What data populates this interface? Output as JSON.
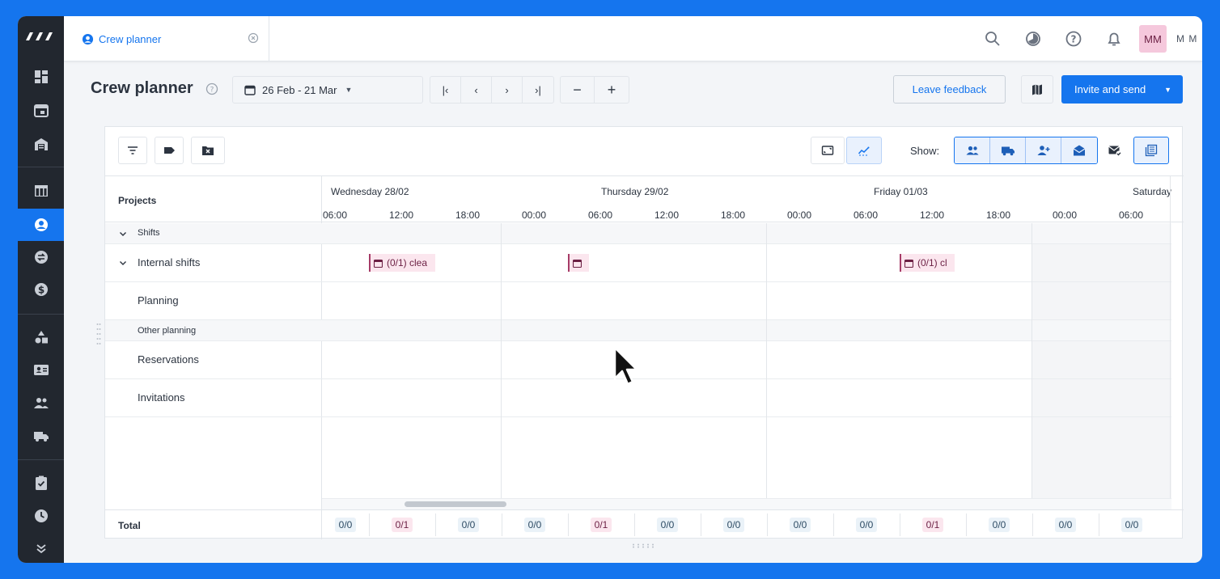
{
  "app": {
    "tab_label": "Crew planner",
    "user_initials": "MM",
    "user_name": "M M",
    "accent_color": "#1575ee",
    "rail_icons": [
      "dashboard-icon",
      "calendar-icon",
      "warehouse-icon",
      "table-icon",
      "crew-icon",
      "swap-icon",
      "dollar-icon",
      "shapes-icon",
      "contact-card-icon",
      "people-icon",
      "truck-icon",
      "clipboard-check-icon",
      "clock-icon",
      "expand-down-icon"
    ]
  },
  "header": {
    "title": "Crew planner",
    "date_range": "26 Feb - 21 Mar",
    "leave_feedback": "Leave feedback",
    "invite_and_send": "Invite and send"
  },
  "toolbar": {
    "show_label": "Show:"
  },
  "grid": {
    "projects_label": "Projects",
    "days": [
      "Wednesday 28/02",
      "Thursday 29/02",
      "Friday 01/03",
      "Saturday"
    ],
    "hours": [
      "06:00",
      "12:00",
      "18:00",
      "00:00",
      "06:00",
      "12:00",
      "18:00",
      "00:00",
      "06:00",
      "12:00",
      "18:00",
      "00:00",
      "06:00"
    ],
    "rows": {
      "shifts": "Shifts",
      "internal_shifts": "Internal shifts",
      "planning": "Planning",
      "other_planning": "Other planning",
      "reservations": "Reservations",
      "invitations": "Invitations"
    },
    "shift_blocks": [
      "(0/1) clea",
      "",
      "(0/1) cl"
    ],
    "total_label": "Total",
    "totals": [
      "0/0",
      "0/1",
      "0/0",
      "0/0",
      "0/1",
      "0/0",
      "0/0",
      "0/0",
      "0/0",
      "0/1",
      "0/0",
      "0/0",
      "0/0"
    ]
  }
}
